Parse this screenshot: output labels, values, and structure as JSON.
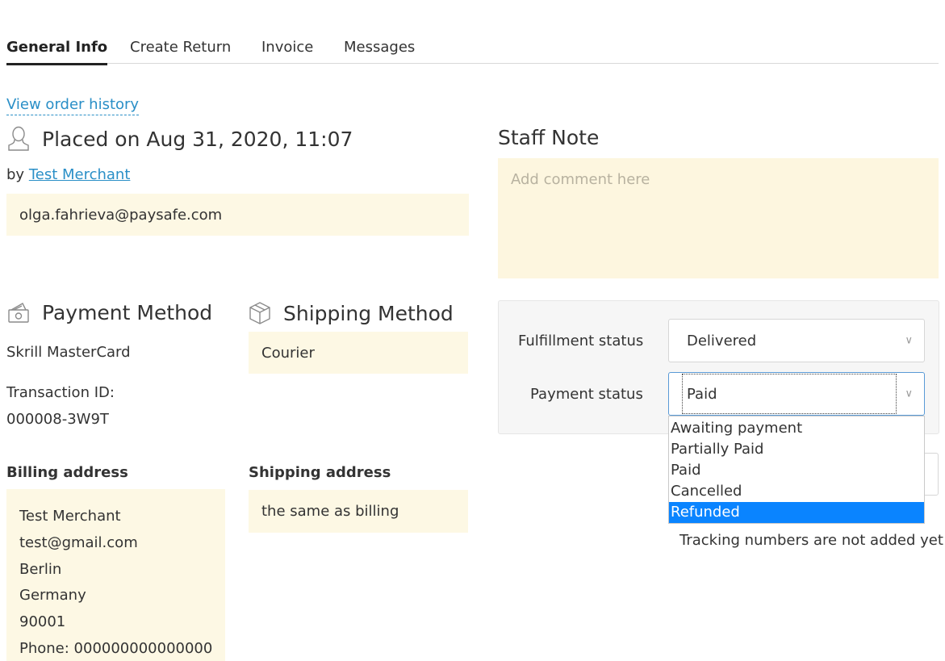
{
  "tabs": [
    {
      "label": "General Info",
      "active": true
    },
    {
      "label": "Create Return",
      "active": false
    },
    {
      "label": "Invoice",
      "active": false
    },
    {
      "label": "Messages",
      "active": false
    }
  ],
  "order": {
    "history_link": "View order history",
    "placed_text": "Placed on Aug 31, 2020, 11:07",
    "by_prefix": "by",
    "merchant_link": "Test Merchant",
    "email": "olga.fahrieva@paysafe.com"
  },
  "staff_note": {
    "title": "Staff Note",
    "placeholder": "Add comment here"
  },
  "payment": {
    "title": "Payment Method",
    "method": "Skrill MasterCard",
    "transaction_label": "Transaction ID:",
    "transaction_id": "000008-3W9T"
  },
  "shipping": {
    "title": "Shipping Method",
    "method": "Courier"
  },
  "billing_address": {
    "label": "Billing address",
    "lines": [
      "Test Merchant",
      "test@gmail.com",
      "Berlin",
      "Germany",
      "90001",
      "Phone: 000000000000000"
    ]
  },
  "shipping_address": {
    "label": "Shipping address",
    "value": "the same as billing"
  },
  "status": {
    "fulfillment_label": "Fulfillment status",
    "fulfillment_value": "Delivered",
    "payment_label": "Payment status",
    "payment_value": "Paid",
    "payment_options": [
      "Awaiting payment",
      "Partially Paid",
      "Paid",
      "Cancelled",
      "Refunded"
    ],
    "highlighted_option": "Refunded"
  },
  "tracking": {
    "message": "Tracking numbers are not added yet"
  },
  "icons": {
    "placed": "user-icon",
    "payment": "money-icon",
    "shipping": "box-icon",
    "chevron": "chevron-down-icon"
  },
  "colors": {
    "link": "#2a8fc7",
    "field_bg": "#fdf8e4",
    "dropdown_highlight": "#0a84ff"
  }
}
